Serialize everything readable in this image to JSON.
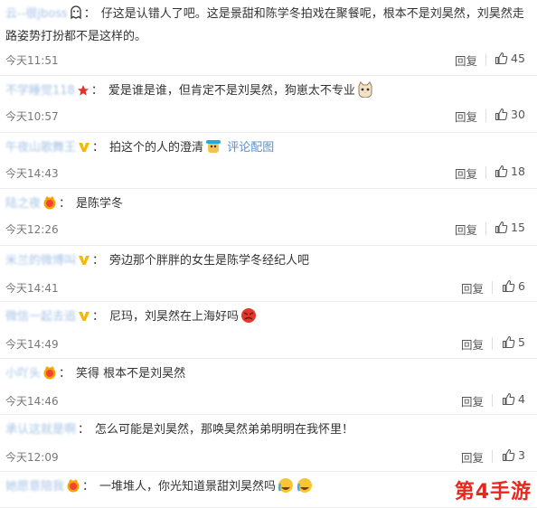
{
  "comments": [
    {
      "user": "云--很jboss",
      "badge": "ghost",
      "text_before": "仔这是认错人了吧。这是景甜和陈学冬拍戏在聚餐呢，根本不是刘昊然，刘昊然走路姿势打扮都不是这样的。",
      "emoji_after": "",
      "link": "",
      "time": "今天11:51",
      "reply": "回复",
      "likes": "45"
    },
    {
      "user": "不学睡觉118",
      "badge": "star",
      "text_before": "爱是谁是谁，但肯定不是刘昊然，狗崽太不专业",
      "emoji_after": "cat",
      "link": "",
      "time": "今天10:57",
      "reply": "回复",
      "likes": "30"
    },
    {
      "user": "午夜山歌舞王",
      "badge": "v-gold",
      "text_before": "拍这个的人的澄清",
      "emoji_after": "doge",
      "link": "评论配图",
      "time": "今天14:43",
      "reply": "回复",
      "likes": "18"
    },
    {
      "user": "陆之夜",
      "badge": "crown",
      "text_before": "是陈学冬",
      "emoji_after": "",
      "link": "",
      "time": "今天12:26",
      "reply": "回复",
      "likes": "15"
    },
    {
      "user": "米兰的微博叫",
      "badge": "v-gold",
      "text_before": "旁边那个胖胖的女生是陈学冬经纪人吧",
      "emoji_after": "",
      "link": "",
      "time": "今天14:41",
      "reply": "回复",
      "likes": "6"
    },
    {
      "user": "微信一起去追",
      "badge": "v-gold",
      "text_before": "尼玛，刘昊然在上海好吗",
      "emoji_after": "angry",
      "link": "",
      "time": "今天14:49",
      "reply": "回复",
      "likes": "5"
    },
    {
      "user": "小吖头",
      "badge": "crown",
      "text_before": "笑得 根本不是刘昊然",
      "emoji_after": "",
      "link": "",
      "time": "今天14:46",
      "reply": "回复",
      "likes": "4"
    },
    {
      "user": "承认这就是啊",
      "badge": "",
      "text_before": "怎么可能是刘昊然，那唤昊然弟弟明明在我怀里！",
      "emoji_after": "",
      "link": "",
      "time": "今天12:09",
      "reply": "回复",
      "likes": "3"
    },
    {
      "user": "她愿意陪我",
      "badge": "crown",
      "text_before": "一堆堆人，你光知道景甜刘昊然吗",
      "emoji_after": "laugh-cry",
      "link": "",
      "time": "",
      "reply": "",
      "likes": ""
    }
  ],
  "watermark": "第4手游",
  "colors": {
    "link": "#5a8fd0",
    "text": "#333333",
    "time": "#777777",
    "watermark": "#e8281d",
    "v_badge": "#f5b800",
    "star": "#e6332a"
  }
}
